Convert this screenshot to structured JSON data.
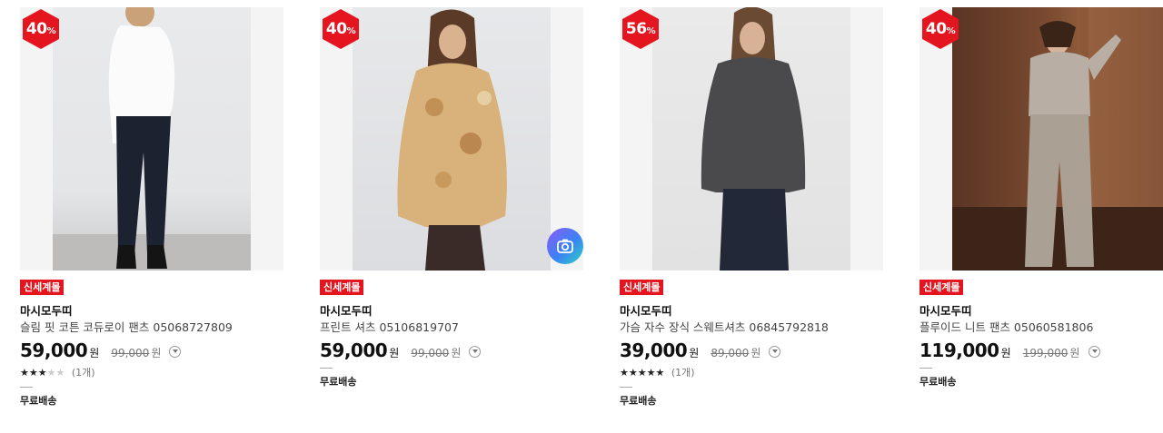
{
  "colors": {
    "accent": "#e4151f"
  },
  "products": [
    {
      "discount": "40",
      "discount_unit": "%",
      "tag": "신세계몰",
      "brand": "마시모두띠",
      "name": "슬림 핏 코튼 코듀로이 팬츠 05068727809",
      "price": "59,000",
      "price_unit": "원",
      "original_price": "99,000",
      "original_unit": "원",
      "rating_stars": 3,
      "review_count": "(1개)",
      "shipping": "무료배송"
    },
    {
      "discount": "40",
      "discount_unit": "%",
      "tag": "신세계몰",
      "brand": "마시모두띠",
      "name": "프린트 셔츠 05106819707",
      "price": "59,000",
      "price_unit": "원",
      "original_price": "99,000",
      "original_unit": "원",
      "shipping": "무료배송",
      "photo_search_icon": "camera-icon"
    },
    {
      "discount": "56",
      "discount_unit": "%",
      "tag": "신세계몰",
      "brand": "마시모두띠",
      "name": "가슴 자수 장식 스웨트셔츠 06845792818",
      "price": "39,000",
      "price_unit": "원",
      "original_price": "89,000",
      "original_unit": "원",
      "rating_stars": 5,
      "review_count": "(1개)",
      "shipping": "무료배송"
    },
    {
      "discount": "40",
      "discount_unit": "%",
      "tag": "신세계몰",
      "brand": "마시모두띠",
      "name": "플루이드 니트 팬츠 05060581806",
      "price": "119,000",
      "price_unit": "원",
      "original_price": "199,000",
      "original_unit": "원",
      "shipping": "무료배송"
    }
  ]
}
